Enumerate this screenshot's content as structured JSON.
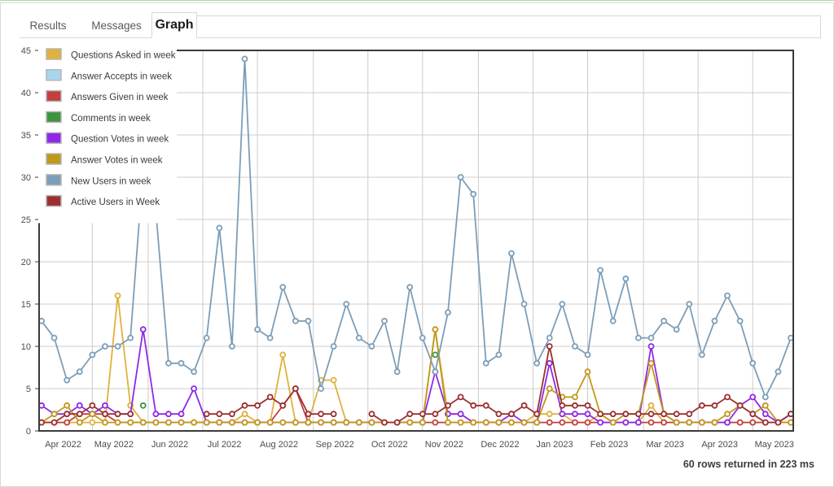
{
  "window": {
    "accent_top_border": "#b8d4b0",
    "background": "#ffffff"
  },
  "tabs": [
    {
      "label": "Results",
      "active": false
    },
    {
      "label": "Messages",
      "active": false
    },
    {
      "label": "Graph",
      "active": true
    }
  ],
  "footer": {
    "status": "60 rows returned in 223 ms"
  },
  "chart_data": {
    "type": "line",
    "title": "",
    "xlabel": "",
    "ylabel": "",
    "ylim": [
      0,
      45
    ],
    "ytick_step": 5,
    "yticks": [
      0,
      5,
      10,
      15,
      20,
      25,
      30,
      35,
      40,
      45
    ],
    "grid": true,
    "legend_position": "top-left",
    "x_tick_labels": [
      "Apr 2022",
      "May 2022",
      "Jun 2022",
      "Jul 2022",
      "Aug 2022",
      "Sep 2022",
      "Oct 2022",
      "Nov 2022",
      "Dec 2022",
      "Jan 2023",
      "Feb 2023",
      "Mar 2023",
      "Apr 2023",
      "May 2023"
    ],
    "x_tick_indices": [
      1.7,
      5.7,
      10.1,
      14.4,
      18.7,
      23.1,
      27.4,
      31.7,
      36.1,
      40.4,
      44.7,
      49.1,
      53.4,
      57.7
    ],
    "x_count": 60,
    "marker": "circle-open",
    "series": [
      {
        "name": "Questions Asked in week",
        "color": "#E0B13C",
        "values": [
          1,
          1,
          1,
          1,
          1,
          1,
          16,
          3,
          1,
          null,
          null,
          null,
          1,
          1,
          1,
          1,
          2,
          1,
          1,
          9,
          1,
          1,
          6,
          6,
          1,
          1,
          1,
          1,
          1,
          1,
          1,
          12,
          2,
          2,
          1,
          1,
          1,
          1,
          1,
          2,
          2,
          2,
          1,
          1,
          2,
          1,
          1,
          1,
          3,
          1,
          1,
          1,
          1,
          1,
          1,
          1,
          1,
          1,
          1,
          1
        ]
      },
      {
        "name": "Answer Accepts in week",
        "color": "#A8D4F0",
        "values": [
          null,
          null,
          null,
          null,
          null,
          null,
          null,
          null,
          1,
          null,
          null,
          null,
          null,
          null,
          null,
          null,
          null,
          null,
          null,
          null,
          null,
          null,
          null,
          null,
          null,
          null,
          null,
          null,
          null,
          null,
          null,
          null,
          null,
          null,
          null,
          null,
          null,
          null,
          null,
          null,
          null,
          null,
          null,
          null,
          null,
          null,
          null,
          null,
          null,
          null,
          null,
          null,
          null,
          null,
          null,
          null,
          null,
          null,
          null,
          null
        ]
      },
      {
        "name": "Answers Given in week",
        "color": "#C0403C",
        "values": [
          1,
          1,
          1,
          2,
          2,
          2,
          1,
          1,
          1,
          1,
          1,
          1,
          1,
          1,
          1,
          1,
          1,
          1,
          1,
          3,
          5,
          1,
          1,
          1,
          1,
          1,
          1,
          1,
          1,
          1,
          1,
          1,
          1,
          1,
          1,
          1,
          1,
          1,
          1,
          1,
          1,
          1,
          1,
          1,
          1,
          1,
          1,
          1,
          1,
          1,
          1,
          1,
          1,
          1,
          1,
          1,
          1,
          1,
          1,
          1
        ]
      },
      {
        "name": "Comments in week",
        "color": "#3C9440",
        "values": [
          null,
          null,
          null,
          null,
          null,
          null,
          null,
          null,
          3,
          null,
          null,
          null,
          null,
          null,
          null,
          null,
          null,
          null,
          null,
          null,
          null,
          1,
          null,
          null,
          null,
          null,
          1,
          null,
          null,
          null,
          null,
          9,
          null,
          null,
          null,
          null,
          null,
          null,
          null,
          null,
          null,
          null,
          null,
          null,
          null,
          null,
          null,
          null,
          null,
          null,
          null,
          null,
          null,
          null,
          1,
          null,
          null,
          null,
          null,
          null
        ]
      },
      {
        "name": "Question Votes in week",
        "color": "#9028E8",
        "values": [
          3,
          2,
          2,
          3,
          2,
          3,
          2,
          2,
          12,
          2,
          2,
          2,
          5,
          1,
          1,
          1,
          1,
          1,
          1,
          1,
          1,
          1,
          1,
          1,
          1,
          1,
          1,
          1,
          1,
          1,
          1,
          7,
          2,
          2,
          1,
          1,
          1,
          2,
          1,
          1,
          8,
          2,
          2,
          2,
          1,
          1,
          1,
          1,
          10,
          2,
          1,
          1,
          1,
          1,
          1,
          3,
          4,
          2,
          1,
          2
        ]
      },
      {
        "name": "Answer Votes in week",
        "color": "#C0981C",
        "values": [
          1,
          2,
          3,
          1,
          2,
          1,
          1,
          1,
          1,
          1,
          1,
          1,
          1,
          1,
          1,
          1,
          1,
          1,
          1,
          1,
          1,
          1,
          1,
          1,
          1,
          1,
          1,
          1,
          1,
          1,
          1,
          12,
          1,
          1,
          1,
          1,
          1,
          1,
          1,
          1,
          5,
          4,
          4,
          7,
          2,
          1,
          2,
          2,
          8,
          2,
          1,
          1,
          1,
          1,
          2,
          3,
          2,
          3,
          1,
          1
        ]
      },
      {
        "name": "New Users in week",
        "color": "#7C9EB8",
        "values": [
          13,
          11,
          6,
          7,
          9,
          10,
          10,
          11,
          31,
          26,
          8,
          8,
          7,
          11,
          24,
          10,
          44,
          12,
          11,
          17,
          13,
          13,
          5,
          10,
          15,
          11,
          10,
          13,
          7,
          17,
          11,
          7,
          14,
          30,
          28,
          8,
          9,
          21,
          15,
          8,
          11,
          15,
          10,
          9,
          19,
          13,
          18,
          11,
          11,
          13,
          12,
          15,
          9,
          13,
          16,
          13,
          8,
          4,
          7,
          11
        ]
      },
      {
        "name": "Active Users in Week",
        "color": "#9C3030",
        "values": [
          1,
          1,
          2,
          2,
          3,
          2,
          2,
          2,
          null,
          null,
          null,
          null,
          null,
          2,
          2,
          2,
          3,
          3,
          4,
          3,
          5,
          2,
          2,
          2,
          null,
          null,
          2,
          1,
          1,
          2,
          2,
          2,
          3,
          4,
          3,
          3,
          2,
          2,
          3,
          2,
          10,
          3,
          3,
          3,
          2,
          2,
          2,
          2,
          2,
          2,
          2,
          2,
          3,
          3,
          4,
          3,
          2,
          1,
          1,
          2
        ]
      }
    ]
  },
  "legend": [
    {
      "label": "Questions Asked in week",
      "color": "#E0B13C"
    },
    {
      "label": "Answer Accepts in week",
      "color": "#A8D4F0"
    },
    {
      "label": "Answers Given in week",
      "color": "#C0403C"
    },
    {
      "label": "Comments in week",
      "color": "#3C9440"
    },
    {
      "label": "Question Votes in week",
      "color": "#9028E8"
    },
    {
      "label": "Answer Votes in week",
      "color": "#C0981C"
    },
    {
      "label": "New Users in week",
      "color": "#7C9EB8"
    },
    {
      "label": "Active Users in Week",
      "color": "#9C3030"
    }
  ]
}
